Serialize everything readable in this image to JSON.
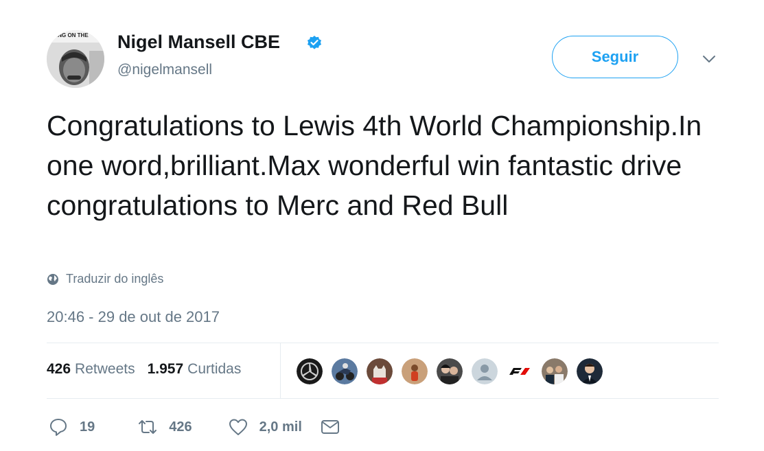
{
  "author": {
    "display_name": "Nigel Mansell CBE",
    "handle": "@nigelmansell",
    "avatar_caption": "ING ON THE"
  },
  "follow_button_label": "Seguir",
  "tweet": {
    "text": "Congratulations to Lewis 4th World Championship.In one word,brilliant.Max wonderful win fantastic drive congratulations to Merc and Red Bull",
    "translate_label": "Traduzir do inglês",
    "timestamp": "20:46 - 29 de out de 2017"
  },
  "stats": {
    "retweets_count": "426",
    "retweets_label": "Retweets",
    "likes_count": "1.957",
    "likes_label": "Curtidas"
  },
  "likers": [
    {
      "name": "mercedes-logo-avatar"
    },
    {
      "name": "motorcycle-avatar"
    },
    {
      "name": "cat-avatar"
    },
    {
      "name": "person-avatar"
    },
    {
      "name": "couple-avatar"
    },
    {
      "name": "default-avatar"
    },
    {
      "name": "f1-logo-avatar"
    },
    {
      "name": "group-avatar"
    },
    {
      "name": "man-avatar"
    }
  ],
  "actions": {
    "reply_count": "19",
    "retweet_count": "426",
    "like_count": "2,0 mil"
  },
  "colors": {
    "accent": "#1da1f2",
    "text_primary": "#14171a",
    "text_secondary": "#657786",
    "divider": "#e6ecf0"
  }
}
